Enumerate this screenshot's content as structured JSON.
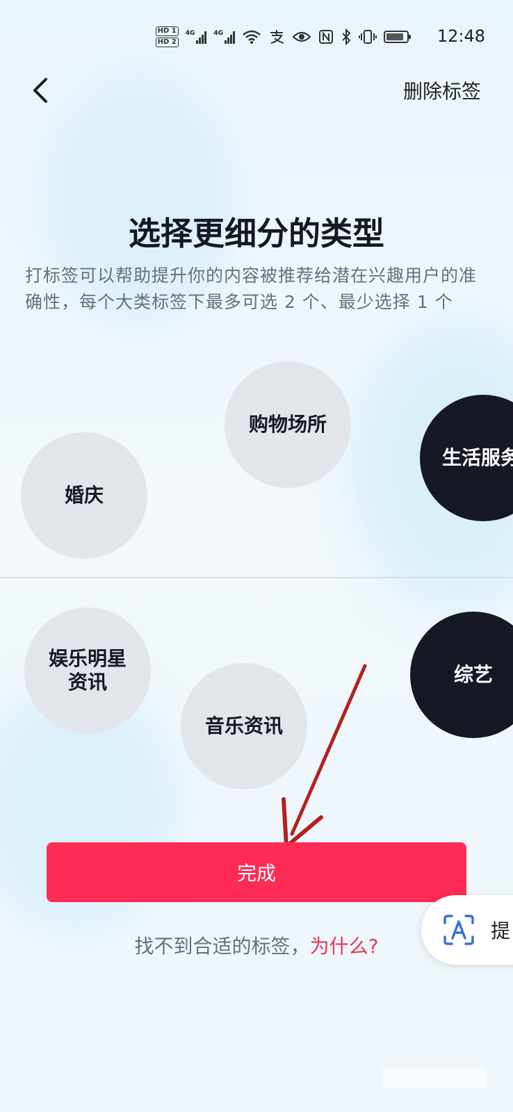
{
  "status_bar": {
    "time": "12:48",
    "sim1": "HD 1",
    "sim2": "HD 2",
    "network1": "4G",
    "network2": "4G"
  },
  "header": {
    "delete_label": "删除标签"
  },
  "title": "选择更细分的类型",
  "subtitle": "打标签可以帮助提升你的内容被推荐给潜在兴趣用户的准确性，每个大类标签下最多可选 2 个、最少选择 1 个",
  "tags": {
    "shopping": "购物场所",
    "wedding": "婚庆",
    "life_service": "生活服务",
    "entertainment": "娱乐明星\n资讯",
    "music": "音乐资讯",
    "variety": "综艺"
  },
  "done_label": "完成",
  "help": {
    "text": "找不到合适的标签，",
    "link": "为什么?"
  },
  "float_tool": {
    "label": "提"
  },
  "colors": {
    "accent": "#fe2c55",
    "selected_tag": "#161823",
    "unselected_tag": "#e2e6ea"
  }
}
